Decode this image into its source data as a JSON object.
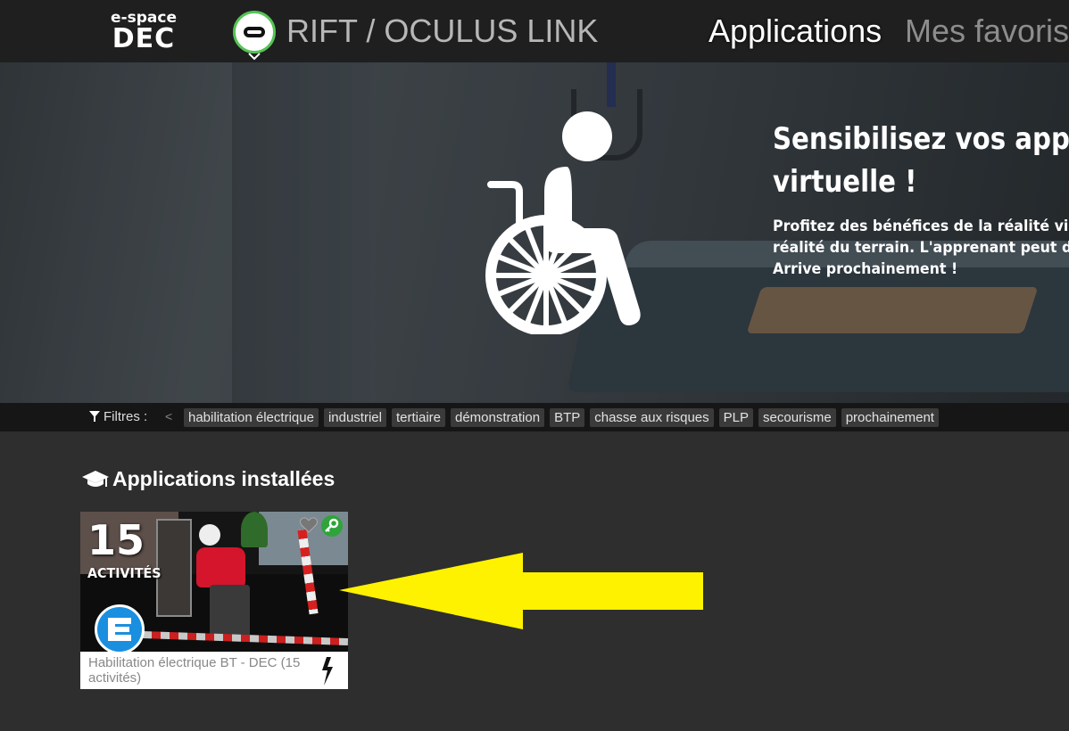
{
  "header": {
    "logo_top": "e-space",
    "logo_bottom": "DEC",
    "device_title": "RIFT / OCULUS LINK",
    "nav": [
      {
        "label": "Applications"
      },
      {
        "label": "Mes favoris"
      }
    ]
  },
  "hero": {
    "title_lines": [
      "Sensibilisez vos appre",
      "virtuelle !"
    ],
    "text_lines": [
      "Profitez des bénéfices de la réalité virt",
      "réalité du terrain. L'apprenant peut don",
      "Arrive prochainement !"
    ]
  },
  "filters": {
    "label": "Filtres :",
    "prev": "<",
    "chips": [
      {
        "label": "habilitation électrique"
      },
      {
        "label": "industriel"
      },
      {
        "label": "tertiaire"
      },
      {
        "label": "démonstration"
      },
      {
        "label": "BTP"
      },
      {
        "label": "chasse aux risques"
      },
      {
        "label": "PLP"
      },
      {
        "label": "secourisme"
      },
      {
        "label": "prochainement"
      }
    ]
  },
  "installed": {
    "title": "Applications installées",
    "cards": [
      {
        "count": "15",
        "count_label": "ACTIVITÉS",
        "title": "Habilitation électrique BT - DEC (15 activités)"
      }
    ]
  },
  "colors": {
    "accent_green": "#56c356",
    "badge_blue": "#1a8fe0",
    "annotation_arrow": "#fff200"
  },
  "icons": [
    "oculus-headset-icon",
    "chevron-down-icon",
    "wheelchair-icon",
    "filter-icon",
    "graduation-cap-icon",
    "heart-icon",
    "key-icon",
    "e-logo-icon",
    "lightning-bolt-icon"
  ]
}
